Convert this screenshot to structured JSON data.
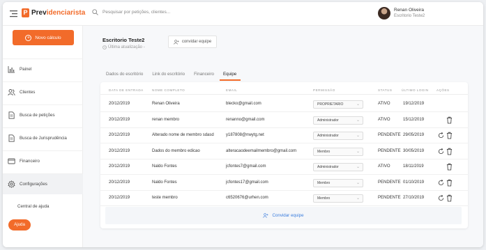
{
  "header": {
    "logo_prefix": "Prev",
    "logo_suffix": "idenciarista",
    "search_placeholder": "Pesquisar por petições, clientes...",
    "user_name": "Renan Oliveira",
    "user_office": "Escritorio Teste2"
  },
  "sidebar": {
    "new_button": "Novo cálculo",
    "items": [
      {
        "label": "Painel",
        "icon": "chart-icon"
      },
      {
        "label": "Clientes",
        "icon": "users-icon"
      },
      {
        "label": "Busca de petições",
        "icon": "document-icon"
      },
      {
        "label": "Busca de Jurisprudência",
        "icon": "document-icon"
      },
      {
        "label": "Financeiro",
        "icon": "card-icon"
      },
      {
        "label": "Configurações",
        "icon": "gear-icon"
      }
    ],
    "help_link": "Central de ajuda",
    "help_button": "Ajuda"
  },
  "main": {
    "office_title": "Escritorio Teste2",
    "last_update": "Última atualização -",
    "invite_button": "convidar equipe",
    "tabs": [
      "Dados do escritório",
      "Link do escritório",
      "Financeiro",
      "Equipe"
    ],
    "active_tab": "Equipe"
  },
  "table": {
    "headers": [
      "DATA DE ENTRADA",
      "NOME COMPLETO",
      "EMAIL",
      "PERMISSÃO",
      "STATUS",
      "ÚLTIMO LOGIN",
      "AÇÕES"
    ],
    "rows": [
      {
        "date": "20/12/2019",
        "name": "Renan Oliveira",
        "email": "blecko@gmail.com",
        "permission": "PROPRIETARIO",
        "status": "ATIVO",
        "last_login": "19/12/2019",
        "actions": []
      },
      {
        "date": "20/12/2019",
        "name": "renan membro",
        "email": "renanno@gmail.com",
        "permission": "Administrador",
        "status": "ATIVO",
        "last_login": "15/12/2019",
        "actions": [
          "trash"
        ]
      },
      {
        "date": "20/12/2019",
        "name": "Alterado nome de membro sdasd",
        "email": "y187808@nwytg.net",
        "permission": "Administrador",
        "status": "PENDENTE",
        "last_login": "29/05/2019",
        "actions": [
          "resend",
          "trash"
        ]
      },
      {
        "date": "20/12/2019",
        "name": "Dados do membro edicao",
        "email": "alteracaodeemailmembro@gmail.com",
        "permission": "Membro",
        "status": "PENDENTE",
        "last_login": "30/05/2019",
        "actions": [
          "resend",
          "trash"
        ]
      },
      {
        "date": "20/12/2019",
        "name": "Naldo Fontes",
        "email": "jcfontes7@gmail.com",
        "permission": "Administrador",
        "status": "ATIVO",
        "last_login": "18/11/2019",
        "actions": [
          "trash"
        ]
      },
      {
        "date": "20/12/2019",
        "name": "Naldo Fontes",
        "email": "jcfontes17@gmail.com",
        "permission": "Membro",
        "status": "PENDENTE",
        "last_login": "01/10/2019",
        "actions": [
          "resend",
          "trash"
        ]
      },
      {
        "date": "20/12/2019",
        "name": "teste membro",
        "email": "c6520676@urhen.com",
        "permission": "Membro",
        "status": "PENDENTE",
        "last_login": "27/10/2019",
        "actions": [
          "resend",
          "trash"
        ]
      }
    ],
    "invite_label": "Convidar equipe"
  },
  "colors": {
    "accent": "#f26b2a",
    "link": "#3b7ddd"
  }
}
